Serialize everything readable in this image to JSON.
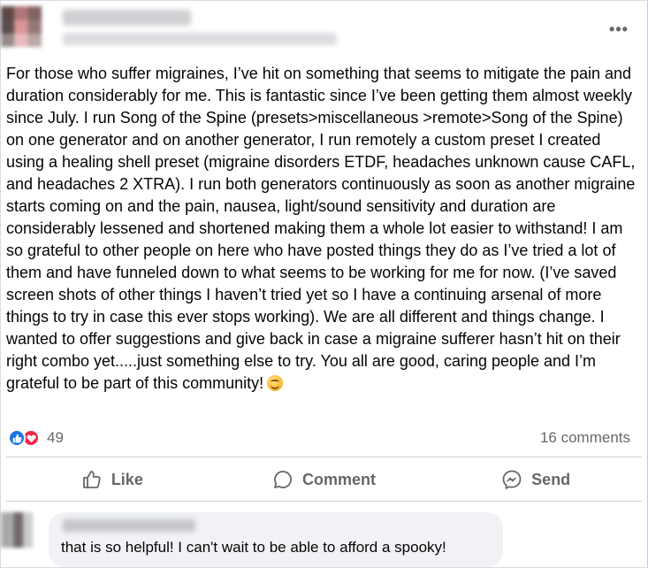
{
  "post": {
    "paragraph": "For those who suffer migraines, I’ve hit on something that seems to mitigate the pain and duration considerably for me. This is fantastic since I’ve been getting them almost weekly since July. I run Song of the Spine (presets>miscellaneous >remote>Song of the Spine) on one generator and on another generator, I run remotely a custom preset I created using a healing shell preset (migraine disorders ETDF, headaches unknown cause CAFL, and headaches 2 XTRA). I run both generators continuously as soon as another migraine starts coming on and the pain, nausea, light/sound sensitivity and duration are considerably lessened and shortened making them a whole lot easier to withstand! I am so grateful to other people on here who have posted things they do as I’ve tried a lot of them and have funneled down to what seems to be working for me for now. (I’ve saved screen shots of other things I haven’t tried yet so I have a continuing arsenal of more things to try in case this ever stops working). We are all different and things change. I  wanted to offer suggestions and give back in case a migraine sufferer hasn’t hit on their right combo yet.....just something else to try. You all are good, caring people and I’m grateful to be part of this community!",
    "emoji_icon": "smiling-face-icon",
    "more_icon": "•••"
  },
  "stats": {
    "reaction_count": "49",
    "reaction_icons": [
      "like-icon",
      "love-icon"
    ],
    "comments": "16 comments"
  },
  "actions": {
    "like_label": "Like",
    "comment_label": "Comment",
    "send_label": "Send"
  },
  "comment": {
    "text": "that is so helpful! I can't wait to be able to afford a spooky!"
  },
  "colors": {
    "like_blue": "#1b74e4",
    "love_red": "#f0284a",
    "secondary_text": "#65676b",
    "bubble_bg": "#f0f2f5"
  }
}
